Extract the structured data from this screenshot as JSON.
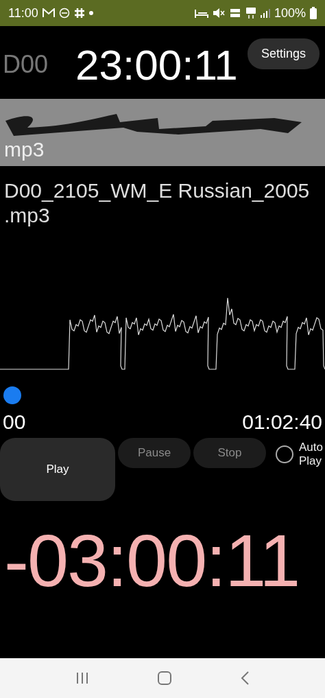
{
  "status_bar": {
    "time": "11:00",
    "battery": "100%"
  },
  "header": {
    "label": "D00",
    "clock": "23:00:11",
    "settings": "Settings"
  },
  "files": [
    {
      "lines": [
        "mp3"
      ],
      "selected": true,
      "redacted": true
    },
    {
      "lines": [
        "D00_2105_WM_E Russian_2005",
        ".mp3"
      ],
      "selected": false,
      "redacted": false
    }
  ],
  "player": {
    "level": 0,
    "start": "00",
    "end": "01:02:40"
  },
  "buttons": [
    {
      "label": "Play",
      "disabled": false
    },
    {
      "label": "Pause",
      "disabled": true
    },
    {
      "label": "Stop",
      "disabled": true
    }
  ],
  "auto_play": {
    "label_lines": [
      "Auto",
      "Play"
    ],
    "checked": false
  },
  "countdown": "-03:00:11"
}
